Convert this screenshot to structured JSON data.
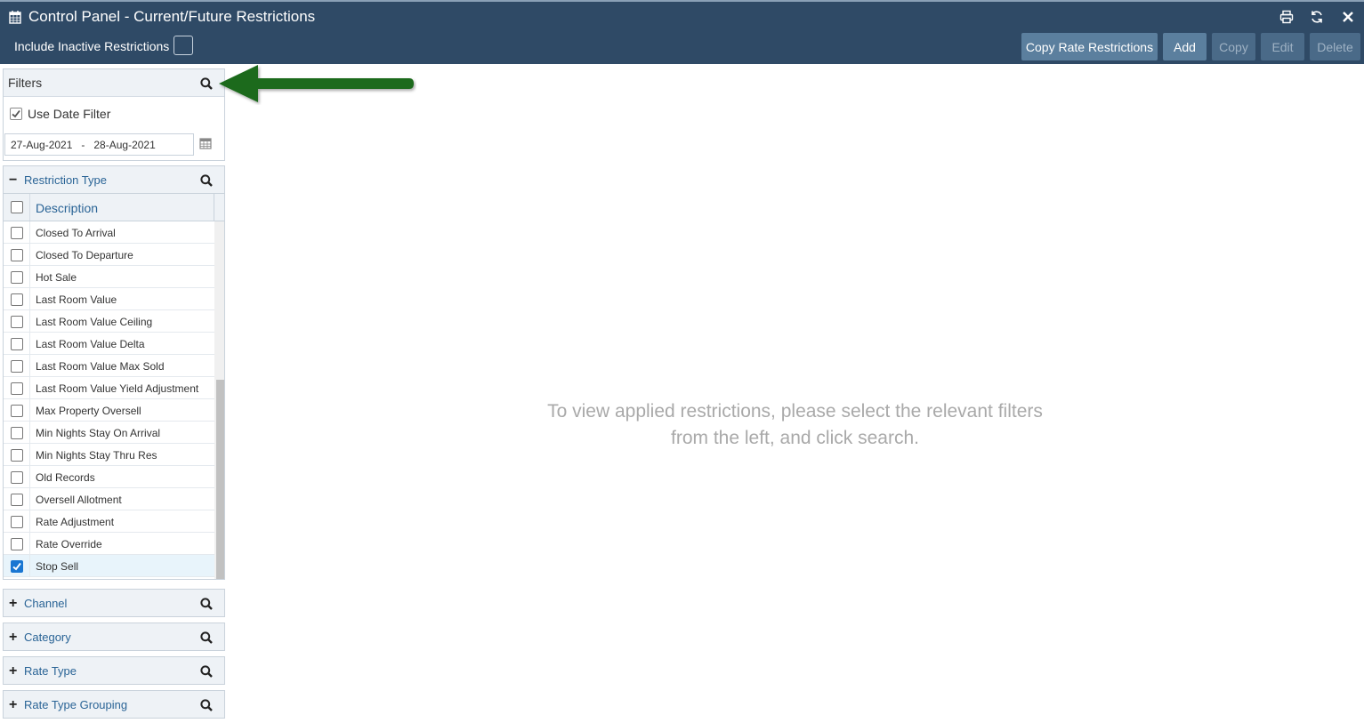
{
  "window": {
    "title": "Control Panel - Current/Future Restrictions",
    "icons": [
      "calendar-icon",
      "print-icon",
      "refresh-icon",
      "close-icon"
    ]
  },
  "toolbar": {
    "include_inactive_label": "Include Inactive Restrictions",
    "include_inactive_checked": false,
    "copy_rate_restrictions": "Copy Rate Restrictions",
    "add": "Add",
    "copy": "Copy",
    "edit": "Edit",
    "delete": "Delete"
  },
  "filters": {
    "title": "Filters",
    "use_date_filter_label": "Use Date Filter",
    "use_date_filter_checked": true,
    "date_from": "27-Aug-2021",
    "date_to": "28-Aug-2021",
    "date_range_text": "27-Aug-2021   -   28-Aug-2021"
  },
  "restriction_type": {
    "label": "Restriction Type",
    "expanded": true,
    "column_header": "Description",
    "items": [
      {
        "label": "Closed To Arrival",
        "checked": false
      },
      {
        "label": "Closed To Departure",
        "checked": false
      },
      {
        "label": "Hot Sale",
        "checked": false
      },
      {
        "label": "Last Room Value",
        "checked": false
      },
      {
        "label": "Last Room Value Ceiling",
        "checked": false
      },
      {
        "label": "Last Room Value Delta",
        "checked": false
      },
      {
        "label": "Last Room Value Max Sold",
        "checked": false
      },
      {
        "label": "Last Room Value Yield Adjustment",
        "checked": false
      },
      {
        "label": "Max Property Oversell",
        "checked": false
      },
      {
        "label": "Min Nights Stay On Arrival",
        "checked": false
      },
      {
        "label": "Min Nights Stay Thru Res",
        "checked": false
      },
      {
        "label": "Old Records",
        "checked": false
      },
      {
        "label": "Oversell Allotment",
        "checked": false
      },
      {
        "label": "Rate Adjustment",
        "checked": false
      },
      {
        "label": "Rate Override",
        "checked": false
      },
      {
        "label": "Stop Sell",
        "checked": true
      }
    ]
  },
  "collapsed_filters": [
    {
      "label": "Channel"
    },
    {
      "label": "Category"
    },
    {
      "label": "Rate Type"
    },
    {
      "label": "Rate Type Grouping"
    }
  ],
  "main": {
    "message_line1": "To view applied restrictions, please select the relevant filters",
    "message_line2": "from the left, and click search."
  },
  "colors": {
    "topbar": "#2f4a66",
    "accent_link": "#2a6496",
    "checkbox_checked": "#1976d2",
    "annotation_arrow": "#1e6b1e"
  }
}
